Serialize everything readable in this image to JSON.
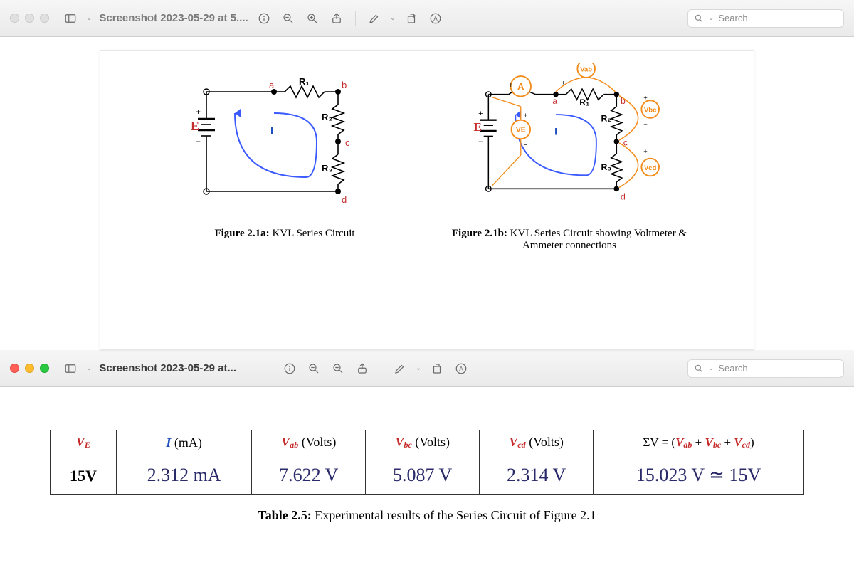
{
  "upper_window": {
    "title": "Screenshot 2023-05-29 at 5....",
    "search_placeholder": "Search"
  },
  "figure_a": {
    "label_E": "E",
    "label_I": "I",
    "label_a": "a",
    "label_b": "b",
    "label_c": "c",
    "label_d": "d",
    "label_R1": "R₁",
    "label_R2": "R₂",
    "label_R3": "R₃",
    "caption_bold": "Figure 2.1a:",
    "caption_rest": " KVL Series Circuit"
  },
  "figure_b": {
    "label_E": "E",
    "label_I": "I",
    "label_a": "a",
    "label_b": "b",
    "label_c": "c",
    "label_d": "d",
    "label_R1": "R₁",
    "label_R2": "R₂",
    "label_R3": "R₃",
    "label_A": "A",
    "label_VE": "VE",
    "label_Vab": "Vab",
    "label_Vbc": "Vbc",
    "label_Vcd": "Vcd",
    "caption_bold": "Figure 2.1b:",
    "caption_rest": " KVL Series Circuit showing Voltmeter & Ammeter connections"
  },
  "lower_window": {
    "title": "Screenshot 2023-05-29 at...",
    "search_placeholder": "Search"
  },
  "table": {
    "headers": {
      "VE": "V",
      "VE_sub": "E",
      "I_label": "I",
      "I_unit": " (mA)",
      "Vab": "V",
      "Vab_sub": "ab",
      "Vab_unit": " (Volts)",
      "Vbc": "V",
      "Vbc_sub": "bc",
      "Vbc_unit": " (Volts)",
      "Vcd": "V",
      "Vcd_sub": "cd",
      "Vcd_unit": " (Volts)",
      "sum_prefix": "ΣV = (",
      "sum_mid1": " + ",
      "sum_mid2": " + ",
      "sum_suffix": ")"
    },
    "row": {
      "VE": "15V",
      "I": "2.312 mA",
      "Vab": "7.622 V",
      "Vbc": "5.087 V",
      "Vcd": "2.314 V",
      "sum": "15.023 V ≃ 15V"
    },
    "caption_bold": "Table 2.5:",
    "caption_rest": " Experimental results of the Series Circuit of Figure 2.1"
  },
  "chart_data": {
    "type": "table",
    "title": "Table 2.5: Experimental results of the Series Circuit of Figure 2.1",
    "columns": [
      "V_E",
      "I (mA)",
      "V_ab (Volts)",
      "V_bc (Volts)",
      "V_cd (Volts)",
      "ΣV = (V_ab + V_bc + V_cd)"
    ],
    "rows": [
      [
        "15V",
        "2.312 mA",
        "7.622 V",
        "5.087 V",
        "2.314 V",
        "15.023 V ≃ 15V"
      ]
    ]
  }
}
